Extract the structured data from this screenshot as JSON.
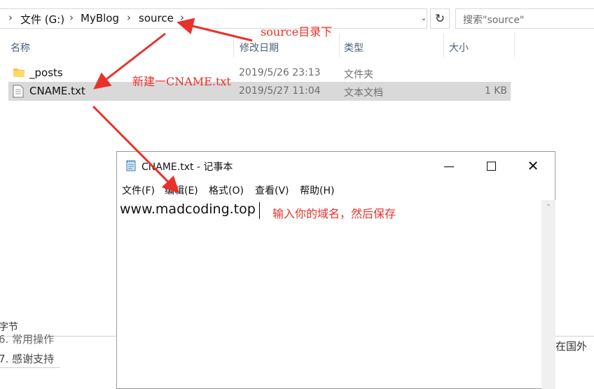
{
  "explorer": {
    "breadcrumb": [
      "文件 (G:)",
      "MyBlog",
      "source"
    ],
    "search_placeholder": "搜索\"source\"",
    "columns": [
      "名称",
      "修改日期",
      "类型",
      "大小"
    ],
    "files": [
      {
        "name": "_posts",
        "date": "2019/5/26 23:13",
        "type": "文件夹",
        "size": "",
        "icon": "folder-icon",
        "selected": false
      },
      {
        "name": "CNAME.txt",
        "date": "2019/5/27 11:04",
        "type": "文本文档",
        "size": "1 KB",
        "icon": "text-file-icon",
        "selected": true
      }
    ]
  },
  "notepad": {
    "title": "CNAME.txt - 记事本",
    "menu": [
      "文件(F)",
      "编辑(E)",
      "格式(O)",
      "查看(V)",
      "帮助(H)"
    ],
    "content": "www.madcoding.top"
  },
  "annotations": {
    "source_dir": "source目录下",
    "new_cname": "新建一CNAME.txt",
    "enter_domain": "输入你的域名，然后保存"
  },
  "background_page": {
    "section_label": "字节",
    "item6": "6. 常用操作",
    "item7": "7. 感谢支持",
    "right_fragment": "在国外"
  },
  "colors": {
    "annotation": "#e8312b",
    "selection": "#d9d9d9",
    "header_text": "#4c607a"
  }
}
